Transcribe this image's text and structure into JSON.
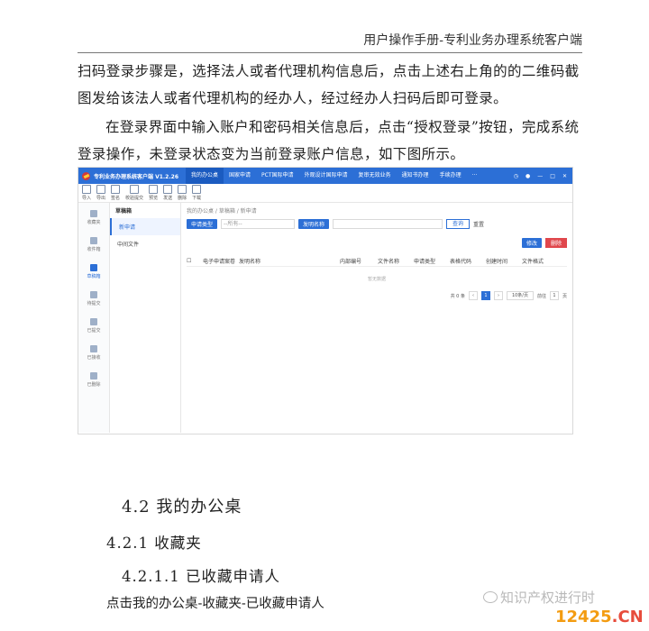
{
  "header": {
    "title": "用户操作手册-专利业务办理系统客户端"
  },
  "body": {
    "p1": "扫码登录步骤是，选择法人或者代理机构信息后，点击上述右上角的的二维码截图发给该法人或者代理机构的经办人，经过经办人扫码后即可登录。",
    "p2": "在登录界面中输入账户和密码相关信息后，点击“授权登录”按钮，完成系统登录操作，未登录状态变为当前登录账户信息，如下图所示。"
  },
  "screenshot": {
    "app_title": "专利业务办理系统客户端 V1.2.26",
    "menu": [
      "我的办公桌",
      "国家申请",
      "PCT国际申请",
      "外观设计国际申请",
      "复审无效业务",
      "通知书办理",
      "手续办理",
      "···"
    ],
    "toolbar": [
      "导入",
      "导出",
      "签名",
      "校验提交",
      "预览",
      "发送",
      "删除",
      "下载"
    ],
    "sidebar": [
      "收藏夹",
      "收件箱",
      "草稿箱",
      "待提交",
      "已提交",
      "已接收",
      "已删除"
    ],
    "tree": {
      "head": "草稿箱",
      "items": [
        "新申请",
        "中间文件"
      ]
    },
    "crumb": "我的办公桌 / 草稿箱 / 新申请",
    "filter": {
      "type_label": "申请类型",
      "type_value": "--所有--",
      "name_label": "发明名称",
      "search": "查询",
      "reset": "重置"
    },
    "actions": {
      "edit": "修改",
      "delete": "删除"
    },
    "columns": [
      "电子申请案卷",
      "发明名称",
      "内部编号",
      "文件名称",
      "申请类型",
      "表格代码",
      "创建时间",
      "文件格式"
    ],
    "empty": "暂无数据",
    "pager": {
      "total": "共 0 条",
      "page": "1",
      "per_page": "10条/页",
      "goto": "前往",
      "goto_page": "1",
      "page_unit": "页"
    }
  },
  "section": {
    "h1": "4.2 我的办公桌",
    "h2": "4.2.1 收藏夹",
    "h3": "4.2.1.1 已收藏申请人",
    "p": "点击我的办公桌-收藏夹-已收藏申请人"
  },
  "watermark": {
    "text": "知识产权进行时",
    "logo_a": "12425",
    "logo_b": ".CN"
  }
}
